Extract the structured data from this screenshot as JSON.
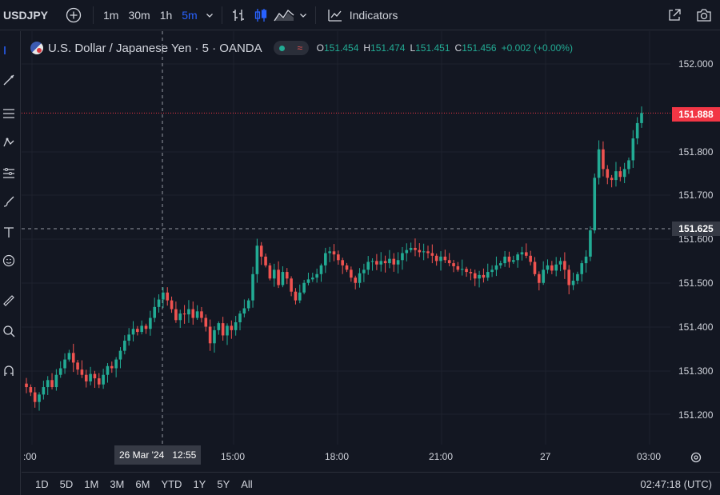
{
  "toolbar": {
    "symbol": "USDJPY",
    "timeframes": [
      "1m",
      "30m",
      "1h",
      "5m"
    ],
    "active_timeframe": "5m",
    "indicators_label": "Indicators"
  },
  "legend": {
    "title": "U.S. Dollar / Japanese Yen · 5 · OANDA",
    "open_key": "O",
    "open": "151.454",
    "high_key": "H",
    "high": "151.474",
    "low_key": "L",
    "low": "151.451",
    "close_key": "C",
    "close": "151.456",
    "change": "+0.002 (+0.00%)"
  },
  "price_axis": {
    "ticks": [
      "152.000",
      "151.800",
      "151.700",
      "151.600",
      "151.500",
      "151.400",
      "151.300",
      "151.200"
    ],
    "last_price": "151.888",
    "crosshair_price": "151.625"
  },
  "time_axis": {
    "ticks": [
      ":00",
      "15:00",
      "18:00",
      "21:00",
      "27",
      "03:00"
    ],
    "crosshair_time": "26 Mar '24   12:55"
  },
  "bottom": {
    "ranges": [
      "1D",
      "5D",
      "1M",
      "3M",
      "6M",
      "YTD",
      "1Y",
      "5Y",
      "All"
    ],
    "clock": "02:47:18 (UTC)"
  },
  "colors": {
    "up": "#22ab94",
    "down": "#ef5350",
    "background": "#131722",
    "accent": "#2962ff"
  },
  "chart_data": {
    "type": "candlestick",
    "series_close": [
      151.262,
      151.25,
      151.228,
      151.245,
      151.262,
      151.278,
      151.262,
      151.29,
      151.305,
      151.325,
      151.34,
      151.318,
      151.302,
      151.29,
      151.275,
      151.292,
      151.282,
      151.268,
      151.29,
      151.31,
      151.305,
      151.325,
      151.345,
      151.368,
      151.382,
      151.395,
      151.388,
      151.402,
      151.395,
      151.42,
      151.445,
      151.462,
      151.478,
      151.46,
      151.44,
      151.415,
      151.43,
      151.428,
      151.44,
      151.42,
      151.435,
      151.42,
      151.4,
      151.362,
      151.392,
      151.408,
      151.38,
      151.402,
      151.392,
      151.41,
      151.43,
      151.442,
      151.46,
      151.52,
      151.585,
      151.56,
      151.54,
      151.51,
      151.53,
      151.495,
      151.525,
      151.51,
      151.48,
      151.46,
      151.478,
      151.5,
      151.508,
      151.512,
      151.52,
      151.54,
      151.568,
      151.572,
      151.565,
      151.552,
      151.54,
      151.53,
      151.512,
      151.5,
      151.522,
      151.53,
      151.548,
      151.55,
      151.542,
      151.55,
      151.545,
      151.555,
      151.542,
      151.552,
      151.568,
      151.575,
      151.58,
      151.575,
      151.57,
      151.572,
      151.568,
      151.562,
      151.55,
      151.56,
      151.552,
      151.545,
      151.538,
      151.53,
      151.532,
      151.525,
      151.522,
      151.51,
      151.518,
      151.512,
      151.525,
      151.53,
      151.54,
      151.545,
      151.56,
      151.548,
      151.552,
      151.565,
      151.57,
      151.562,
      151.548,
      151.52,
      151.5,
      151.53,
      151.54,
      151.528,
      151.542,
      151.55,
      151.53,
      151.495,
      151.505,
      151.52,
      151.545,
      151.56,
      151.62,
      151.74,
      151.805,
      151.76,
      151.74,
      151.735,
      151.755,
      151.742,
      151.76,
      151.78,
      151.83,
      151.865,
      151.888
    ]
  }
}
